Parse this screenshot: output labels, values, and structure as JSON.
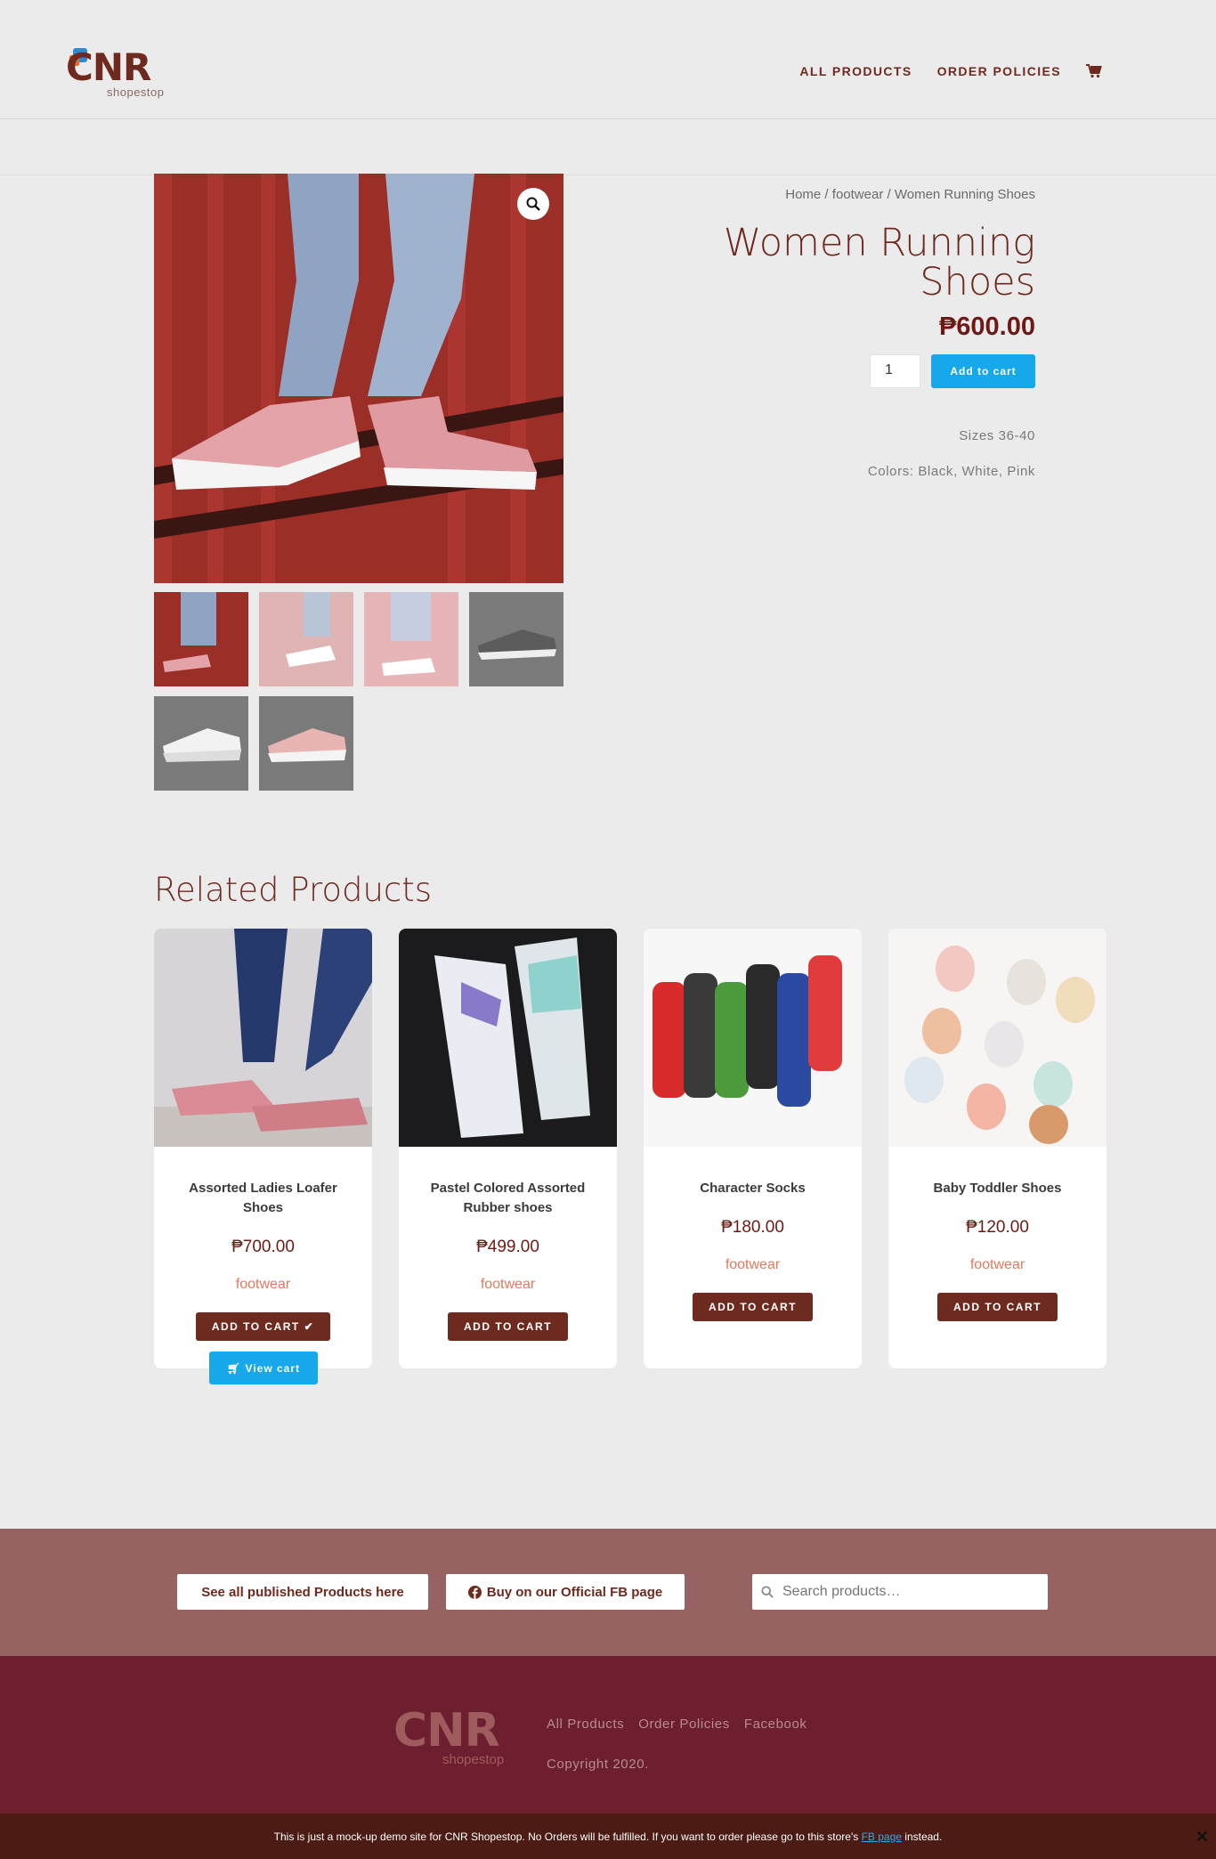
{
  "header": {
    "logo_text": "CNR",
    "logo_sub": "shopestop",
    "nav": [
      "ALL PRODUCTS",
      "ORDER POLICIES"
    ]
  },
  "product": {
    "breadcrumb": {
      "home": "Home",
      "sep1": " / ",
      "category": "footwear",
      "sep2": " / ",
      "current": "Women Running Shoes"
    },
    "title": "Women Running Shoes",
    "price": "₱600.00",
    "quantity": "1",
    "add_to_cart": "Add to cart",
    "sizes": "Sizes 36-40",
    "colors": "Colors: Black, White, Pink"
  },
  "related": {
    "title": "Related Products",
    "items": [
      {
        "name": "Assorted Ladies Loafer Shoes",
        "price": "₱700.00",
        "category": "footwear",
        "button": "ADD TO CART"
      },
      {
        "name": "Pastel Colored Assorted Rubber shoes",
        "price": "₱499.00",
        "category": "footwear",
        "button": "ADD TO CART"
      },
      {
        "name": "Character Socks",
        "price": "₱180.00",
        "category": "footwear",
        "button": "ADD TO CART"
      },
      {
        "name": "Baby Toddler Shoes",
        "price": "₱120.00",
        "category": "footwear",
        "button": "ADD TO CART"
      }
    ],
    "view_cart": "View cart"
  },
  "footer": {
    "btn_products": "See all published Products here",
    "btn_fb": "Buy on our Official FB page",
    "search_placeholder": "Search products…",
    "links": [
      "All Products",
      "Order Policies",
      "Facebook"
    ],
    "copyright": "Copyright 2020.",
    "notice_before": "This is just a mock-up demo site for CNR Shopestop. No Orders will be fulfilled. If you want to order please go to this store's ",
    "notice_link": "FB page",
    "notice_after": " instead."
  },
  "colors": {
    "brand": "#6e2a1f",
    "accent": "#16a8ea",
    "footer_top": "#966262",
    "footer_bottom": "#6e1f2f"
  }
}
